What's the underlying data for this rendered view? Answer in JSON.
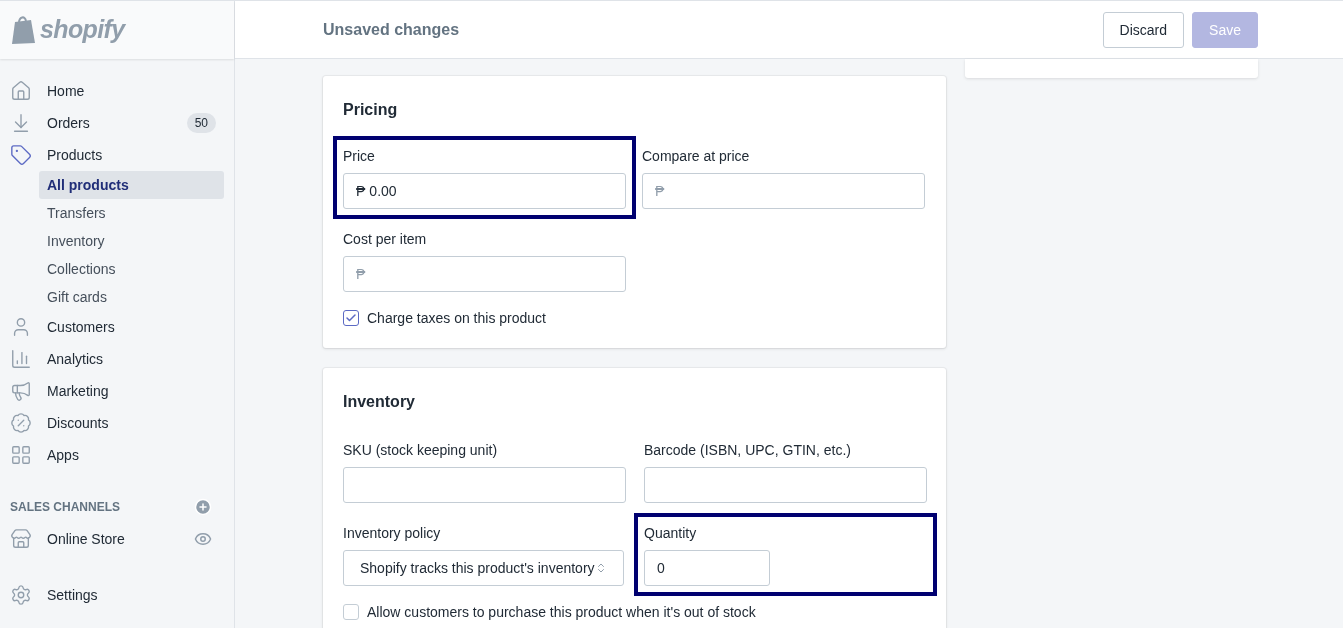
{
  "logo": {
    "text": "shopify"
  },
  "nav": [
    {
      "label": "Home",
      "selected": false
    },
    {
      "label": "Orders",
      "badge": "50",
      "selected": false
    },
    {
      "label": "Products",
      "selected": true,
      "children": [
        {
          "label": "All products",
          "selected": true
        },
        {
          "label": "Transfers",
          "selected": false
        },
        {
          "label": "Inventory",
          "selected": false
        },
        {
          "label": "Collections",
          "selected": false
        },
        {
          "label": "Gift cards",
          "selected": false
        }
      ]
    },
    {
      "label": "Customers",
      "selected": false
    },
    {
      "label": "Analytics",
      "selected": false
    },
    {
      "label": "Marketing",
      "selected": false
    },
    {
      "label": "Discounts",
      "selected": false
    },
    {
      "label": "Apps",
      "selected": false
    }
  ],
  "sales_channels": {
    "title": "SALES CHANNELS",
    "items": [
      {
        "label": "Online Store"
      }
    ]
  },
  "settings": {
    "label": "Settings"
  },
  "header": {
    "title": "Unsaved changes",
    "buttons": [
      {
        "label": "Discard",
        "disabled": false,
        "kind": "secondary"
      },
      {
        "label": "Save",
        "disabled": true,
        "kind": "primary"
      }
    ]
  },
  "pricing": {
    "title": "Pricing",
    "fields": [
      {
        "label": "Price",
        "prefix": "₱",
        "value": "0.00",
        "highlighted": true
      },
      {
        "label": "Compare at price",
        "prefix": "₱",
        "highlighted": false
      },
      {
        "label": "Cost per item",
        "prefix": "₱",
        "highlighted": false
      }
    ],
    "checkbox": {
      "label": "Charge taxes on this product",
      "checked": true
    }
  },
  "inventory": {
    "title": "Inventory",
    "fields": [
      {
        "kind": "text",
        "label": "SKU (stock keeping unit)",
        "highlighted": false
      },
      {
        "kind": "text",
        "label": "Barcode (ISBN, UPC, GTIN, etc.)",
        "highlighted": false
      },
      {
        "kind": "select",
        "label": "Inventory policy",
        "value": "Shopify tracks this product's inventory",
        "highlighted": false
      },
      {
        "kind": "number",
        "label": "Quantity",
        "value": "0",
        "highlighted": true
      }
    ],
    "checkbox": {
      "label": "Allow customers to purchase this product when it's out of stock",
      "checked": false
    }
  }
}
